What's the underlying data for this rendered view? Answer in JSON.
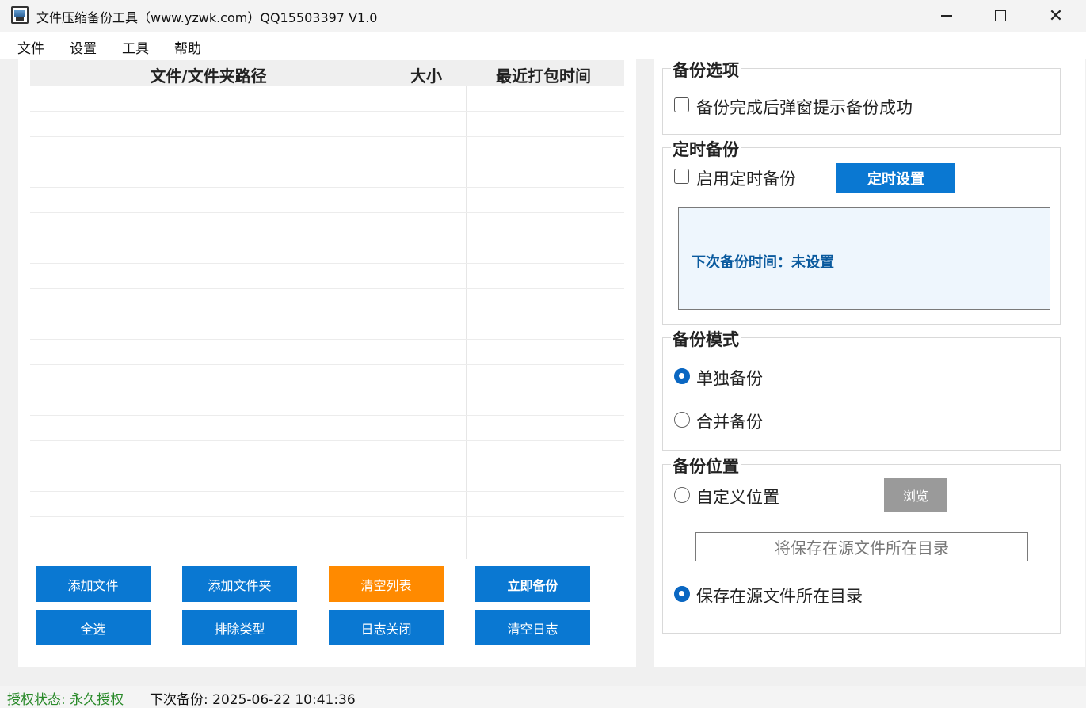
{
  "window": {
    "title": "文件压缩备份工具（www.yzwk.com）QQ15503397  V1.0",
    "minimize_glyph": "",
    "close_glyph": "✕"
  },
  "menu": [
    "文件",
    "设置",
    "工具",
    "帮助"
  ],
  "table": {
    "columns": [
      "文件/文件夹路径",
      "大小",
      "最近打包时间"
    ],
    "rows": []
  },
  "buttons": {
    "add_file": "添加文件",
    "add_folder": "添加文件夹",
    "clear_list": "清空列表",
    "backup_now": "立即备份",
    "select_all": "全选",
    "exclude_types": "排除类型",
    "log_close": "日志关闭",
    "clear_log": "清空日志"
  },
  "backup_options": {
    "title": "备份选项",
    "popup_success_label": "备份完成后弹窗提示备份成功",
    "popup_success_checked": false
  },
  "scheduled_backup": {
    "title": "定时备份",
    "enable_label": "启用定时备份",
    "enable_checked": false,
    "settings_button": "定时设置",
    "next_time_text": "下次备份时间：未设置"
  },
  "backup_mode": {
    "title": "备份模式",
    "options": [
      "单独备份",
      "合并备份"
    ],
    "selected": "单独备份"
  },
  "backup_location": {
    "title": "备份位置",
    "custom_label": "自定义位置",
    "browse_button": "浏览",
    "path_placeholder": "将保存在源文件所在目录",
    "source_dir_label": "保存在源文件所在目录",
    "selected": "保存在源文件所在目录"
  },
  "status": {
    "auth": "授权状态: 永久授权",
    "next_backup": "下次备份: 2025-06-22 10:41:36"
  },
  "colors": {
    "primary_button": "#0a78d2",
    "warning_button": "#ff8a00",
    "disabled_button": "#9a9a9a",
    "auth_status": "#2a8a2a",
    "info_text": "#0a5a9e"
  }
}
